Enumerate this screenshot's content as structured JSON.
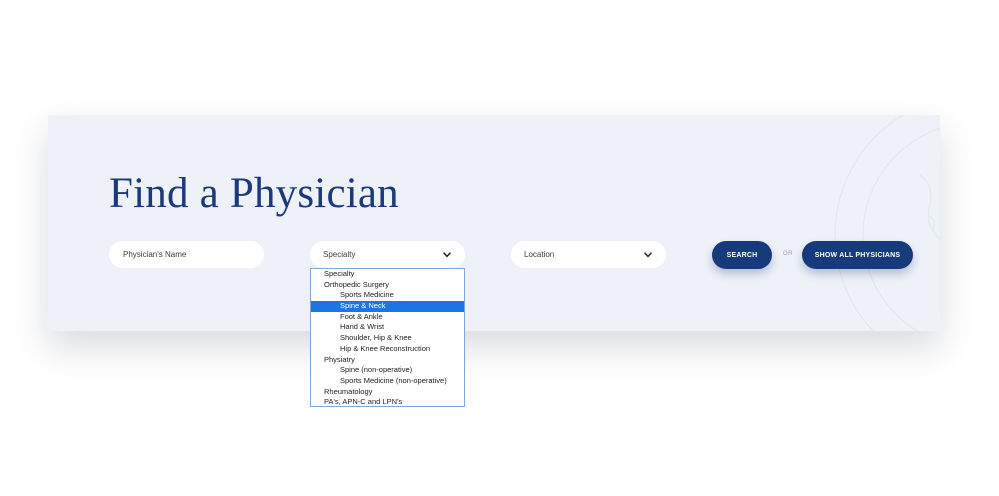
{
  "header": {
    "title": "Find a Physician"
  },
  "search": {
    "name_placeholder": "Physician's Name",
    "specialty": {
      "selected": "Specialty"
    },
    "location": {
      "selected": "Location"
    },
    "search_label": "SEARCH",
    "or_label": "OR",
    "show_all_label": "SHOW ALL PHYSICIANS"
  },
  "dropdown": {
    "options": [
      {
        "label": "Specialty",
        "level": 0,
        "selected": false
      },
      {
        "label": "Orthopedic Surgery",
        "level": 0,
        "selected": false
      },
      {
        "label": "Sports Medicine",
        "level": 1,
        "selected": false
      },
      {
        "label": "Spine & Neck",
        "level": 1,
        "selected": true
      },
      {
        "label": "Foot & Ankle",
        "level": 1,
        "selected": false
      },
      {
        "label": "Hand & Wrist",
        "level": 1,
        "selected": false
      },
      {
        "label": "Shoulder, Hip & Knee",
        "level": 1,
        "selected": false
      },
      {
        "label": "Hip & Knee Reconstruction",
        "level": 1,
        "selected": false
      },
      {
        "label": "Physiatry",
        "level": 0,
        "selected": false
      },
      {
        "label": "Spine (non-operative)",
        "level": 1,
        "selected": false
      },
      {
        "label": "Sports Medicine (non-operative)",
        "level": 1,
        "selected": false
      },
      {
        "label": "Rheumatology",
        "level": 0,
        "selected": false
      },
      {
        "label": "PA's, APN-C and LPN's",
        "level": 0,
        "selected": false
      }
    ]
  },
  "colors": {
    "brand": "#163a7c",
    "title": "#1b3a7a",
    "panel_background": "#eff1f8",
    "highlight": "#1e74e0"
  },
  "icons": {
    "select_chevron": "chevron-down-icon"
  }
}
